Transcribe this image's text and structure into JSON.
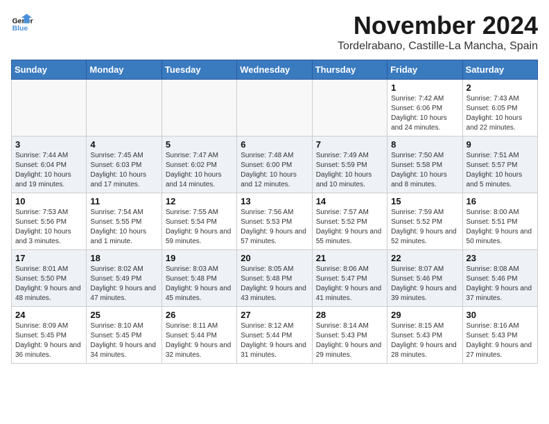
{
  "header": {
    "logo_line1": "General",
    "logo_line2": "Blue",
    "month": "November 2024",
    "location": "Tordelrabano, Castille-La Mancha, Spain"
  },
  "weekdays": [
    "Sunday",
    "Monday",
    "Tuesday",
    "Wednesday",
    "Thursday",
    "Friday",
    "Saturday"
  ],
  "weeks": [
    [
      {
        "day": "",
        "empty": true
      },
      {
        "day": "",
        "empty": true
      },
      {
        "day": "",
        "empty": true
      },
      {
        "day": "",
        "empty": true
      },
      {
        "day": "",
        "empty": true
      },
      {
        "day": "1",
        "sunrise": "7:42 AM",
        "sunset": "6:06 PM",
        "daylight": "10 hours and 24 minutes."
      },
      {
        "day": "2",
        "sunrise": "7:43 AM",
        "sunset": "6:05 PM",
        "daylight": "10 hours and 22 minutes."
      }
    ],
    [
      {
        "day": "3",
        "sunrise": "7:44 AM",
        "sunset": "6:04 PM",
        "daylight": "10 hours and 19 minutes."
      },
      {
        "day": "4",
        "sunrise": "7:45 AM",
        "sunset": "6:03 PM",
        "daylight": "10 hours and 17 minutes."
      },
      {
        "day": "5",
        "sunrise": "7:47 AM",
        "sunset": "6:02 PM",
        "daylight": "10 hours and 14 minutes."
      },
      {
        "day": "6",
        "sunrise": "7:48 AM",
        "sunset": "6:00 PM",
        "daylight": "10 hours and 12 minutes."
      },
      {
        "day": "7",
        "sunrise": "7:49 AM",
        "sunset": "5:59 PM",
        "daylight": "10 hours and 10 minutes."
      },
      {
        "day": "8",
        "sunrise": "7:50 AM",
        "sunset": "5:58 PM",
        "daylight": "10 hours and 8 minutes."
      },
      {
        "day": "9",
        "sunrise": "7:51 AM",
        "sunset": "5:57 PM",
        "daylight": "10 hours and 5 minutes."
      }
    ],
    [
      {
        "day": "10",
        "sunrise": "7:53 AM",
        "sunset": "5:56 PM",
        "daylight": "10 hours and 3 minutes."
      },
      {
        "day": "11",
        "sunrise": "7:54 AM",
        "sunset": "5:55 PM",
        "daylight": "10 hours and 1 minute."
      },
      {
        "day": "12",
        "sunrise": "7:55 AM",
        "sunset": "5:54 PM",
        "daylight": "9 hours and 59 minutes."
      },
      {
        "day": "13",
        "sunrise": "7:56 AM",
        "sunset": "5:53 PM",
        "daylight": "9 hours and 57 minutes."
      },
      {
        "day": "14",
        "sunrise": "7:57 AM",
        "sunset": "5:52 PM",
        "daylight": "9 hours and 55 minutes."
      },
      {
        "day": "15",
        "sunrise": "7:59 AM",
        "sunset": "5:52 PM",
        "daylight": "9 hours and 52 minutes."
      },
      {
        "day": "16",
        "sunrise": "8:00 AM",
        "sunset": "5:51 PM",
        "daylight": "9 hours and 50 minutes."
      }
    ],
    [
      {
        "day": "17",
        "sunrise": "8:01 AM",
        "sunset": "5:50 PM",
        "daylight": "9 hours and 48 minutes."
      },
      {
        "day": "18",
        "sunrise": "8:02 AM",
        "sunset": "5:49 PM",
        "daylight": "9 hours and 47 minutes."
      },
      {
        "day": "19",
        "sunrise": "8:03 AM",
        "sunset": "5:48 PM",
        "daylight": "9 hours and 45 minutes."
      },
      {
        "day": "20",
        "sunrise": "8:05 AM",
        "sunset": "5:48 PM",
        "daylight": "9 hours and 43 minutes."
      },
      {
        "day": "21",
        "sunrise": "8:06 AM",
        "sunset": "5:47 PM",
        "daylight": "9 hours and 41 minutes."
      },
      {
        "day": "22",
        "sunrise": "8:07 AM",
        "sunset": "5:46 PM",
        "daylight": "9 hours and 39 minutes."
      },
      {
        "day": "23",
        "sunrise": "8:08 AM",
        "sunset": "5:46 PM",
        "daylight": "9 hours and 37 minutes."
      }
    ],
    [
      {
        "day": "24",
        "sunrise": "8:09 AM",
        "sunset": "5:45 PM",
        "daylight": "9 hours and 36 minutes."
      },
      {
        "day": "25",
        "sunrise": "8:10 AM",
        "sunset": "5:45 PM",
        "daylight": "9 hours and 34 minutes."
      },
      {
        "day": "26",
        "sunrise": "8:11 AM",
        "sunset": "5:44 PM",
        "daylight": "9 hours and 32 minutes."
      },
      {
        "day": "27",
        "sunrise": "8:12 AM",
        "sunset": "5:44 PM",
        "daylight": "9 hours and 31 minutes."
      },
      {
        "day": "28",
        "sunrise": "8:14 AM",
        "sunset": "5:43 PM",
        "daylight": "9 hours and 29 minutes."
      },
      {
        "day": "29",
        "sunrise": "8:15 AM",
        "sunset": "5:43 PM",
        "daylight": "9 hours and 28 minutes."
      },
      {
        "day": "30",
        "sunrise": "8:16 AM",
        "sunset": "5:43 PM",
        "daylight": "9 hours and 27 minutes."
      }
    ]
  ]
}
